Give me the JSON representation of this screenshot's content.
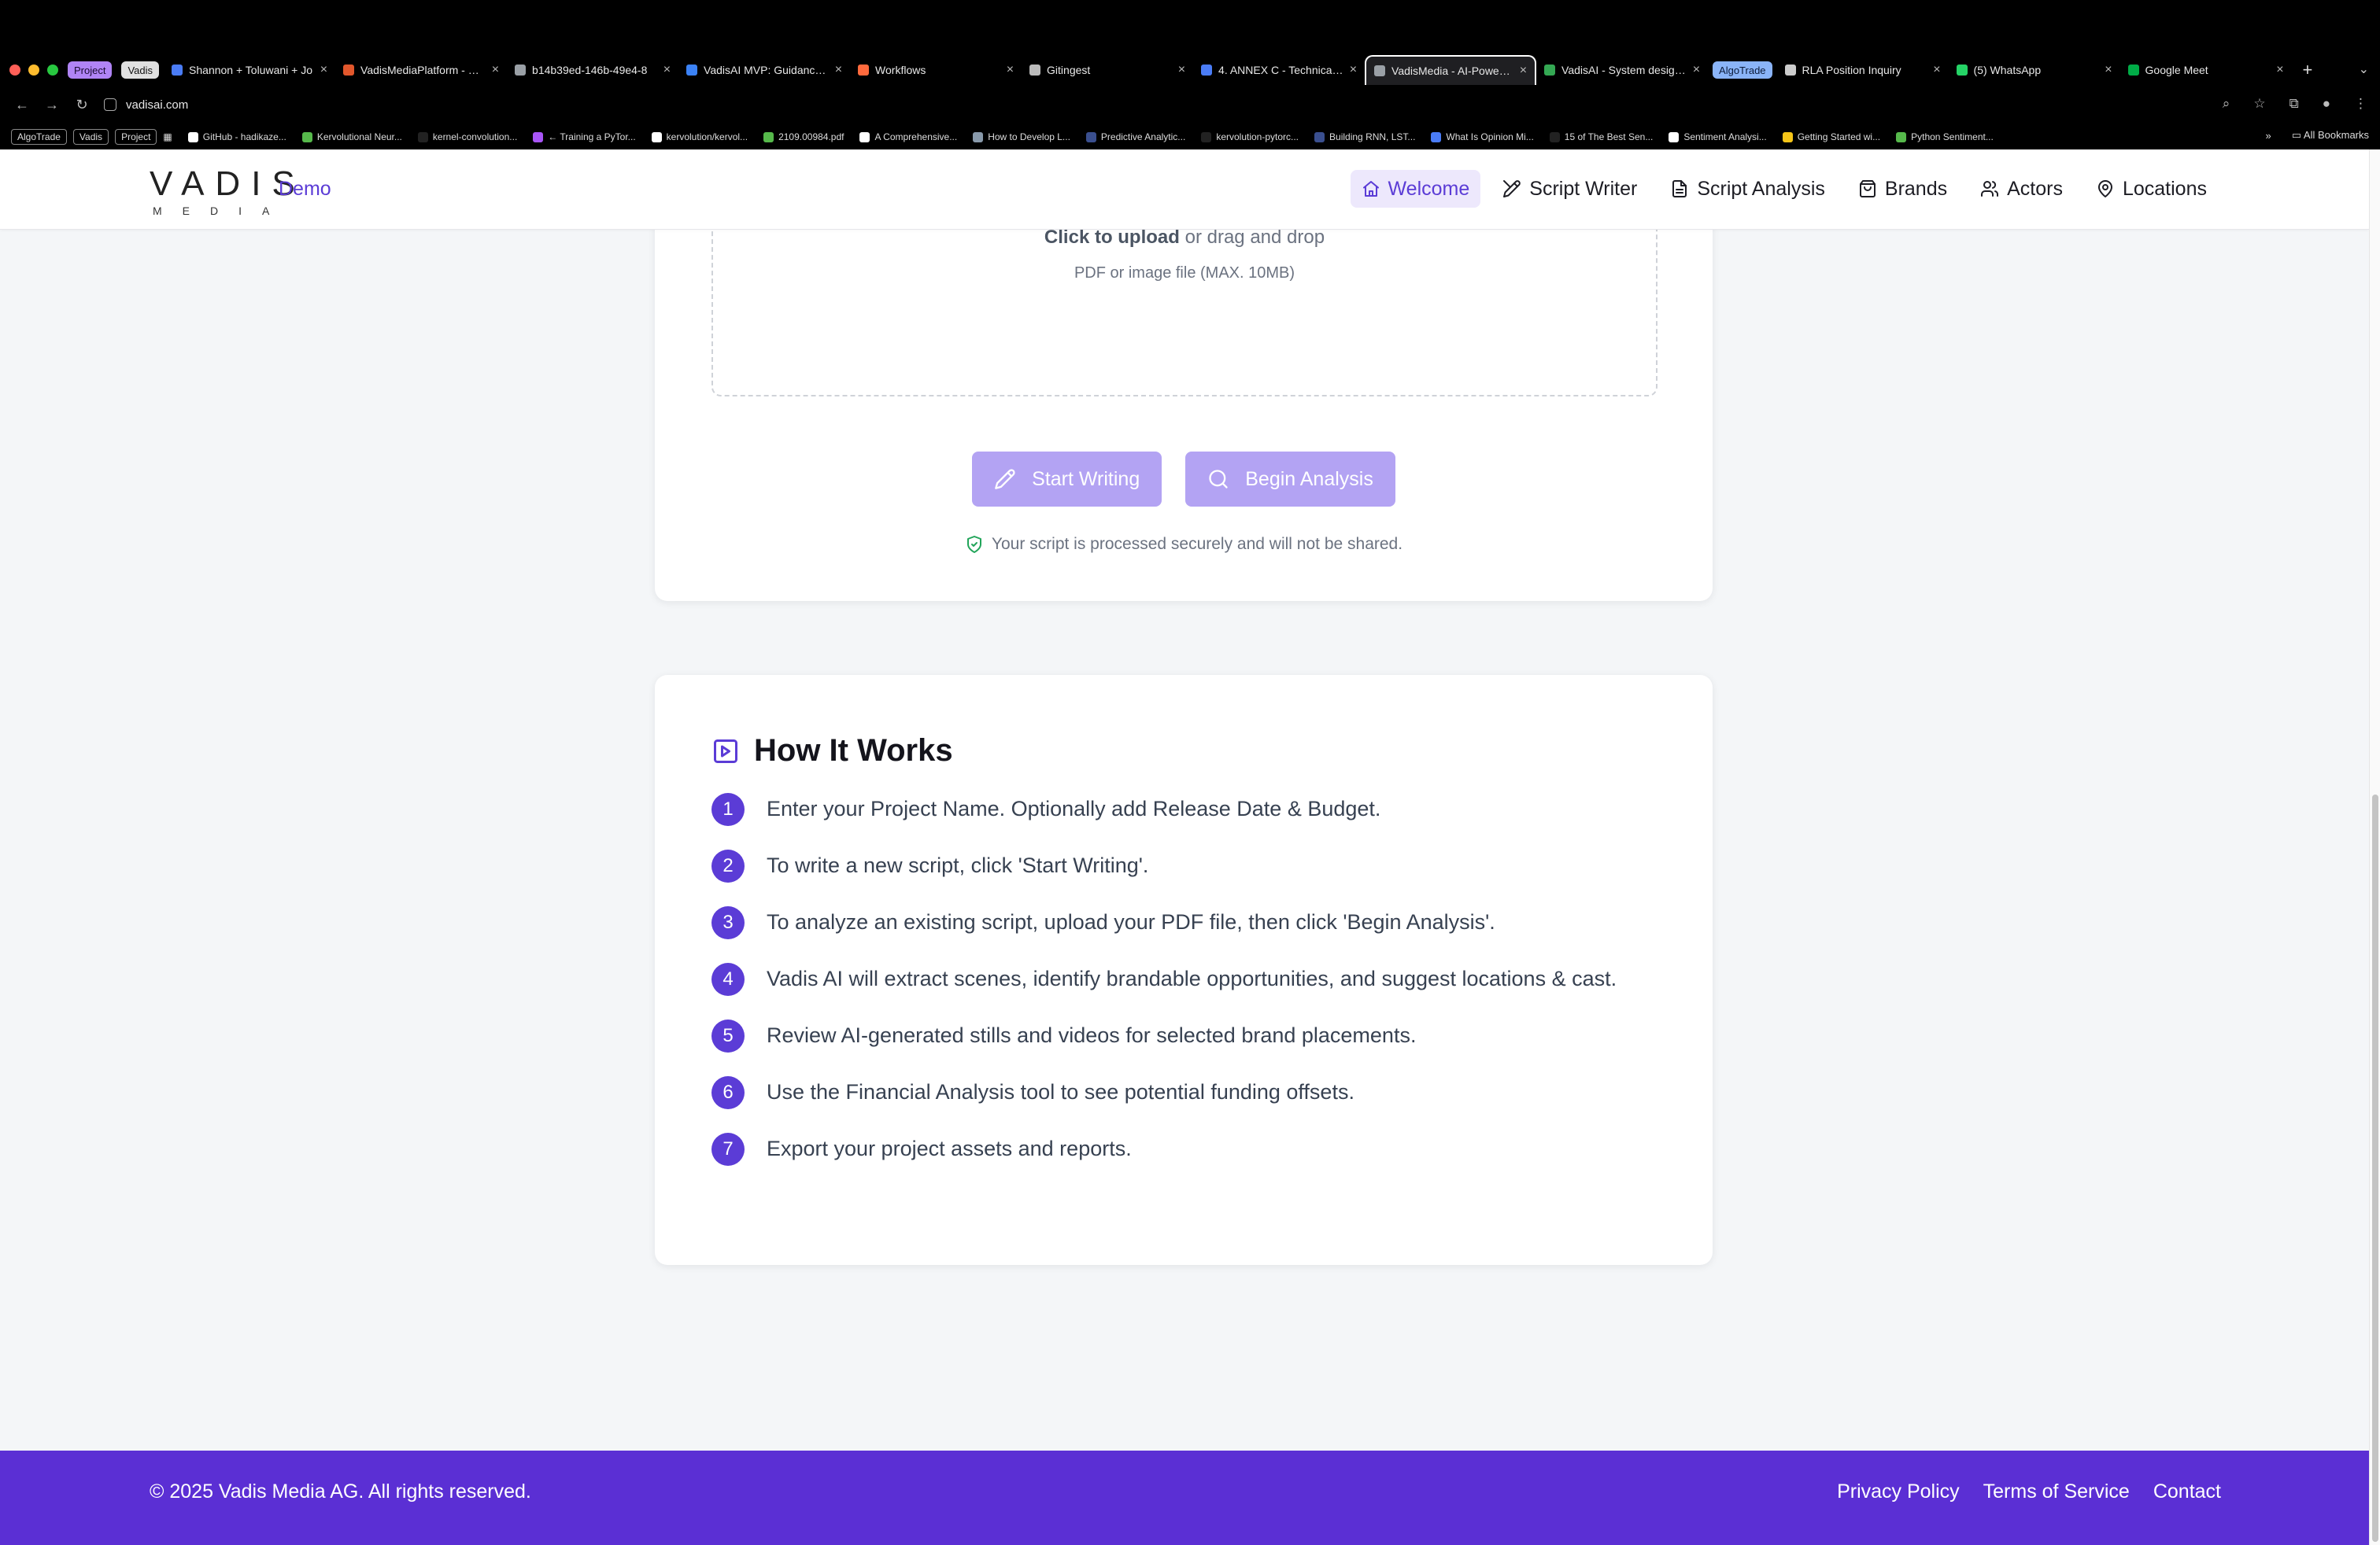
{
  "browser": {
    "tabs": [
      {
        "kind": "chip",
        "label": "Project",
        "bg": "#b084f5",
        "fg": "#1b0b33"
      },
      {
        "kind": "chip",
        "label": "Vadis",
        "bg": "#e0e0e0",
        "fg": "#111111"
      },
      {
        "kind": "tab",
        "label": "Shannon + Toluwani + Jo",
        "fav": "#4a7cf6"
      },
      {
        "kind": "tab",
        "label": "VadisMediaPlatform - Rep",
        "fav": "#e2572c"
      },
      {
        "kind": "tab",
        "label": "b14b39ed-146b-49e4-8",
        "fav": "#9aa0a6"
      },
      {
        "kind": "tab",
        "label": "VadisAI MVP: Guidance N",
        "fav": "#3b82f6"
      },
      {
        "kind": "tab",
        "label": "Workflows",
        "fav": "#ff6a3d"
      },
      {
        "kind": "tab",
        "label": "Gitingest",
        "fav": "#bbbbbb"
      },
      {
        "kind": "tab",
        "label": "4. ANNEX C - Technical R",
        "fav": "#4a7cf6"
      },
      {
        "kind": "tab",
        "label": "VadisMedia - AI-Powered",
        "fav": "#9aa0a6",
        "active": true
      },
      {
        "kind": "tab",
        "label": "VadisAI - System design o",
        "fav": "#34a853"
      },
      {
        "kind": "chip",
        "label": "AlgoTrade",
        "bg": "#8ab4f8",
        "fg": "#0b1b3a"
      },
      {
        "kind": "tab",
        "label": "RLA Position Inquiry",
        "fav": "#cccccc"
      },
      {
        "kind": "tab",
        "label": "(5) WhatsApp",
        "fav": "#25d366"
      },
      {
        "kind": "tab",
        "label": "Google Meet",
        "fav": "#00ac47"
      }
    ],
    "url": "vadisai.com",
    "bookmarks": [
      {
        "kind": "chip",
        "label": "AlgoTrade"
      },
      {
        "kind": "chip",
        "label": "Vadis"
      },
      {
        "kind": "chip",
        "label": "Project"
      },
      {
        "kind": "grid"
      },
      {
        "kind": "bm",
        "label": "GitHub - hadikaze...",
        "fav": "#ffffff"
      },
      {
        "kind": "bm",
        "label": "Kervolutional Neur...",
        "fav": "#56b94b"
      },
      {
        "kind": "bm",
        "label": "kernel-convolution...",
        "fav": "#222222"
      },
      {
        "kind": "bm",
        "label": "← Training a PyTor...",
        "fav": "#a855f7"
      },
      {
        "kind": "bm",
        "label": "kervolution/kervol...",
        "fav": "#ffffff"
      },
      {
        "kind": "bm",
        "label": "2109.00984.pdf",
        "fav": "#56b94b"
      },
      {
        "kind": "bm",
        "label": "A Comprehensive...",
        "fav": "#ffffff"
      },
      {
        "kind": "bm",
        "label": "How to Develop L...",
        "fav": "#8899aa"
      },
      {
        "kind": "bm",
        "label": "Predictive Analytic...",
        "fav": "#3a4f8f"
      },
      {
        "kind": "bm",
        "label": "kervolution-pytorc...",
        "fav": "#222222"
      },
      {
        "kind": "bm",
        "label": "Building RNN, LST...",
        "fav": "#3a4f8f"
      },
      {
        "kind": "bm",
        "label": "What Is Opinion Mi...",
        "fav": "#4a7cf6"
      },
      {
        "kind": "bm",
        "label": "15 of The Best Sen...",
        "fav": "#222222"
      },
      {
        "kind": "bm",
        "label": "Sentiment Analysi...",
        "fav": "#ffffff"
      },
      {
        "kind": "bm",
        "label": "Getting Started wi...",
        "fav": "#f5c518"
      },
      {
        "kind": "bm",
        "label": "Python Sentiment...",
        "fav": "#56b94b"
      }
    ],
    "all_bookmarks": "All Bookmarks"
  },
  "header": {
    "logo_word": "VADIS",
    "logo_sub": "MEDIA",
    "demo": "Demo",
    "nav": [
      {
        "label": "Welcome",
        "icon": "home-icon",
        "active": true
      },
      {
        "label": "Script Writer",
        "icon": "pen-icon"
      },
      {
        "label": "Script Analysis",
        "icon": "document-icon"
      },
      {
        "label": "Brands",
        "icon": "shopping-bag-icon"
      },
      {
        "label": "Actors",
        "icon": "users-icon"
      },
      {
        "label": "Locations",
        "icon": "map-pin-icon"
      }
    ]
  },
  "upload": {
    "click_label": "Click to upload",
    "drag_label": " or drag and drop",
    "file_hint": "PDF or image file (MAX. 10MB)",
    "start_writing": "Start Writing",
    "begin_analysis": "Begin Analysis",
    "secure_note": "Your script is processed securely and will not be shared."
  },
  "how": {
    "title": "How It Works",
    "steps": [
      {
        "n": "1",
        "text": "Enter your Project Name. Optionally add Release Date & Budget."
      },
      {
        "n": "2",
        "text": "To write a new script, click 'Start Writing'."
      },
      {
        "n": "3",
        "text": "To analyze an existing script, upload your PDF file, then click 'Begin Analysis'."
      },
      {
        "n": "4",
        "text": "Vadis AI will extract scenes, identify brandable opportunities, and suggest locations & cast."
      },
      {
        "n": "5",
        "text": "Review AI-generated stills and videos for selected brand placements."
      },
      {
        "n": "6",
        "text": "Use the Financial Analysis tool to see potential funding offsets."
      },
      {
        "n": "7",
        "text": "Export your project assets and reports."
      }
    ]
  },
  "footer": {
    "copyright": "© 2025 Vadis Media AG. All rights reserved.",
    "links": [
      "Privacy Policy",
      "Terms of Service",
      "Contact"
    ]
  },
  "colors": {
    "accent": "#5b3cd6",
    "button_disabled": "#b3a3f3",
    "footer_bg": "#5b2fd4",
    "secure_icon": "#22a55a"
  }
}
